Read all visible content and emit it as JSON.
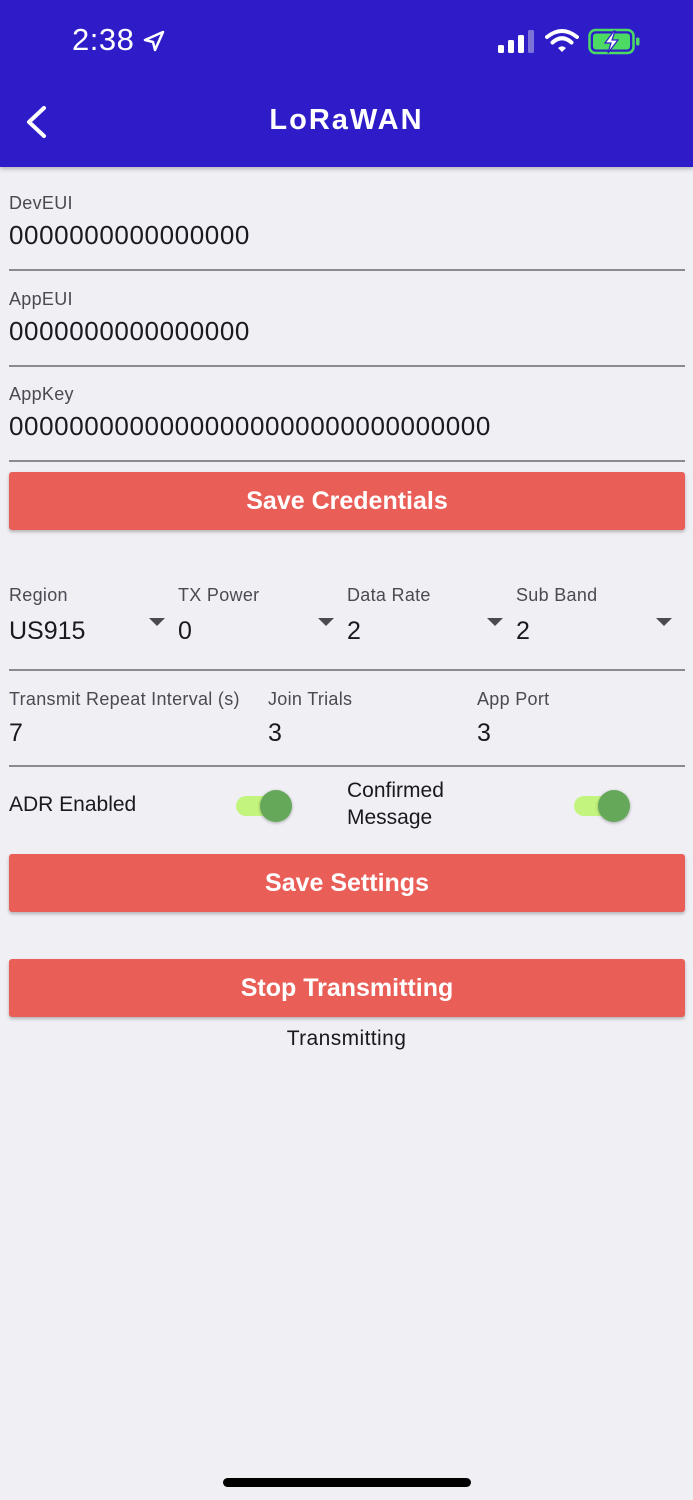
{
  "status_bar": {
    "time": "2:38"
  },
  "header": {
    "title": "LoRaWAN"
  },
  "credentials": {
    "dev_eui": {
      "label": "DevEUI",
      "value": "0000000000000000"
    },
    "app_eui": {
      "label": "AppEUI",
      "value": "0000000000000000"
    },
    "app_key": {
      "label": "AppKey",
      "value": "00000000000000000000000000000000"
    },
    "save_label": "Save Credentials"
  },
  "settings": {
    "region": {
      "label": "Region",
      "value": "US915"
    },
    "tx_power": {
      "label": "TX Power",
      "value": "0"
    },
    "data_rate": {
      "label": "Data Rate",
      "value": "2"
    },
    "sub_band": {
      "label": "Sub Band",
      "value": "2"
    },
    "repeat_interval": {
      "label": "Transmit Repeat Interval (s)",
      "value": "7"
    },
    "join_trials": {
      "label": "Join Trials",
      "value": "3"
    },
    "app_port": {
      "label": "App Port",
      "value": "3"
    },
    "adr": {
      "label": "ADR Enabled",
      "on": true
    },
    "confirmed": {
      "label_line1": "Confirmed",
      "label_line2": "Message",
      "on": true
    },
    "save_label": "Save Settings"
  },
  "transmit": {
    "button_label": "Stop Transmitting",
    "status": "Transmitting"
  },
  "colors": {
    "header_bg": "#2e1cc9",
    "button_bg": "#ea5e58",
    "toggle_track": "#c3f57e",
    "toggle_knob": "#65a85a",
    "battery_fill": "#4cd964"
  },
  "icons": [
    "location-arrow-icon",
    "cellular-signal-icon",
    "wifi-icon",
    "battery-charging-icon",
    "back-chevron-icon",
    "dropdown-arrow-icon"
  ]
}
